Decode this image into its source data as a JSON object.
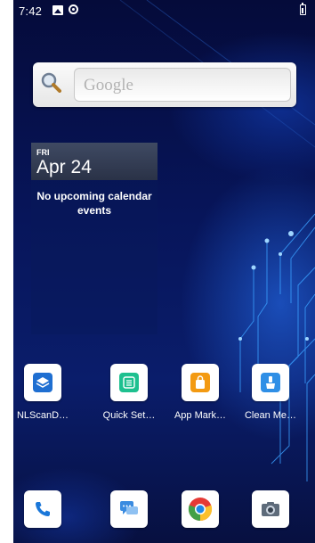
{
  "status_bar": {
    "time": "7:42"
  },
  "search": {
    "placeholder": "Google"
  },
  "calendar": {
    "weekday": "FRI",
    "date": "Apr 24",
    "message": "No upcoming calendar events"
  },
  "apps": [
    {
      "label": "NLScanD…",
      "icon": "nlscan-icon",
      "color": "#1f6fd1"
    },
    {
      "label": "Quick Set…",
      "icon": "quick-settings-icon",
      "color": "#1ec08f"
    },
    {
      "label": "App Mark…",
      "icon": "app-market-icon",
      "color": "#f39a12"
    },
    {
      "label": "Clean Me…",
      "icon": "clean-memory-icon",
      "color": "#2f8fe6"
    }
  ],
  "dock": [
    {
      "icon": "phone-icon",
      "color": "#1a77d9"
    },
    {
      "icon": "messages-icon",
      "color": "#3a8be0"
    },
    {
      "icon": "chrome-icon",
      "color": "#e53935"
    },
    {
      "icon": "camera-icon",
      "color": "#5e6b7a"
    }
  ]
}
